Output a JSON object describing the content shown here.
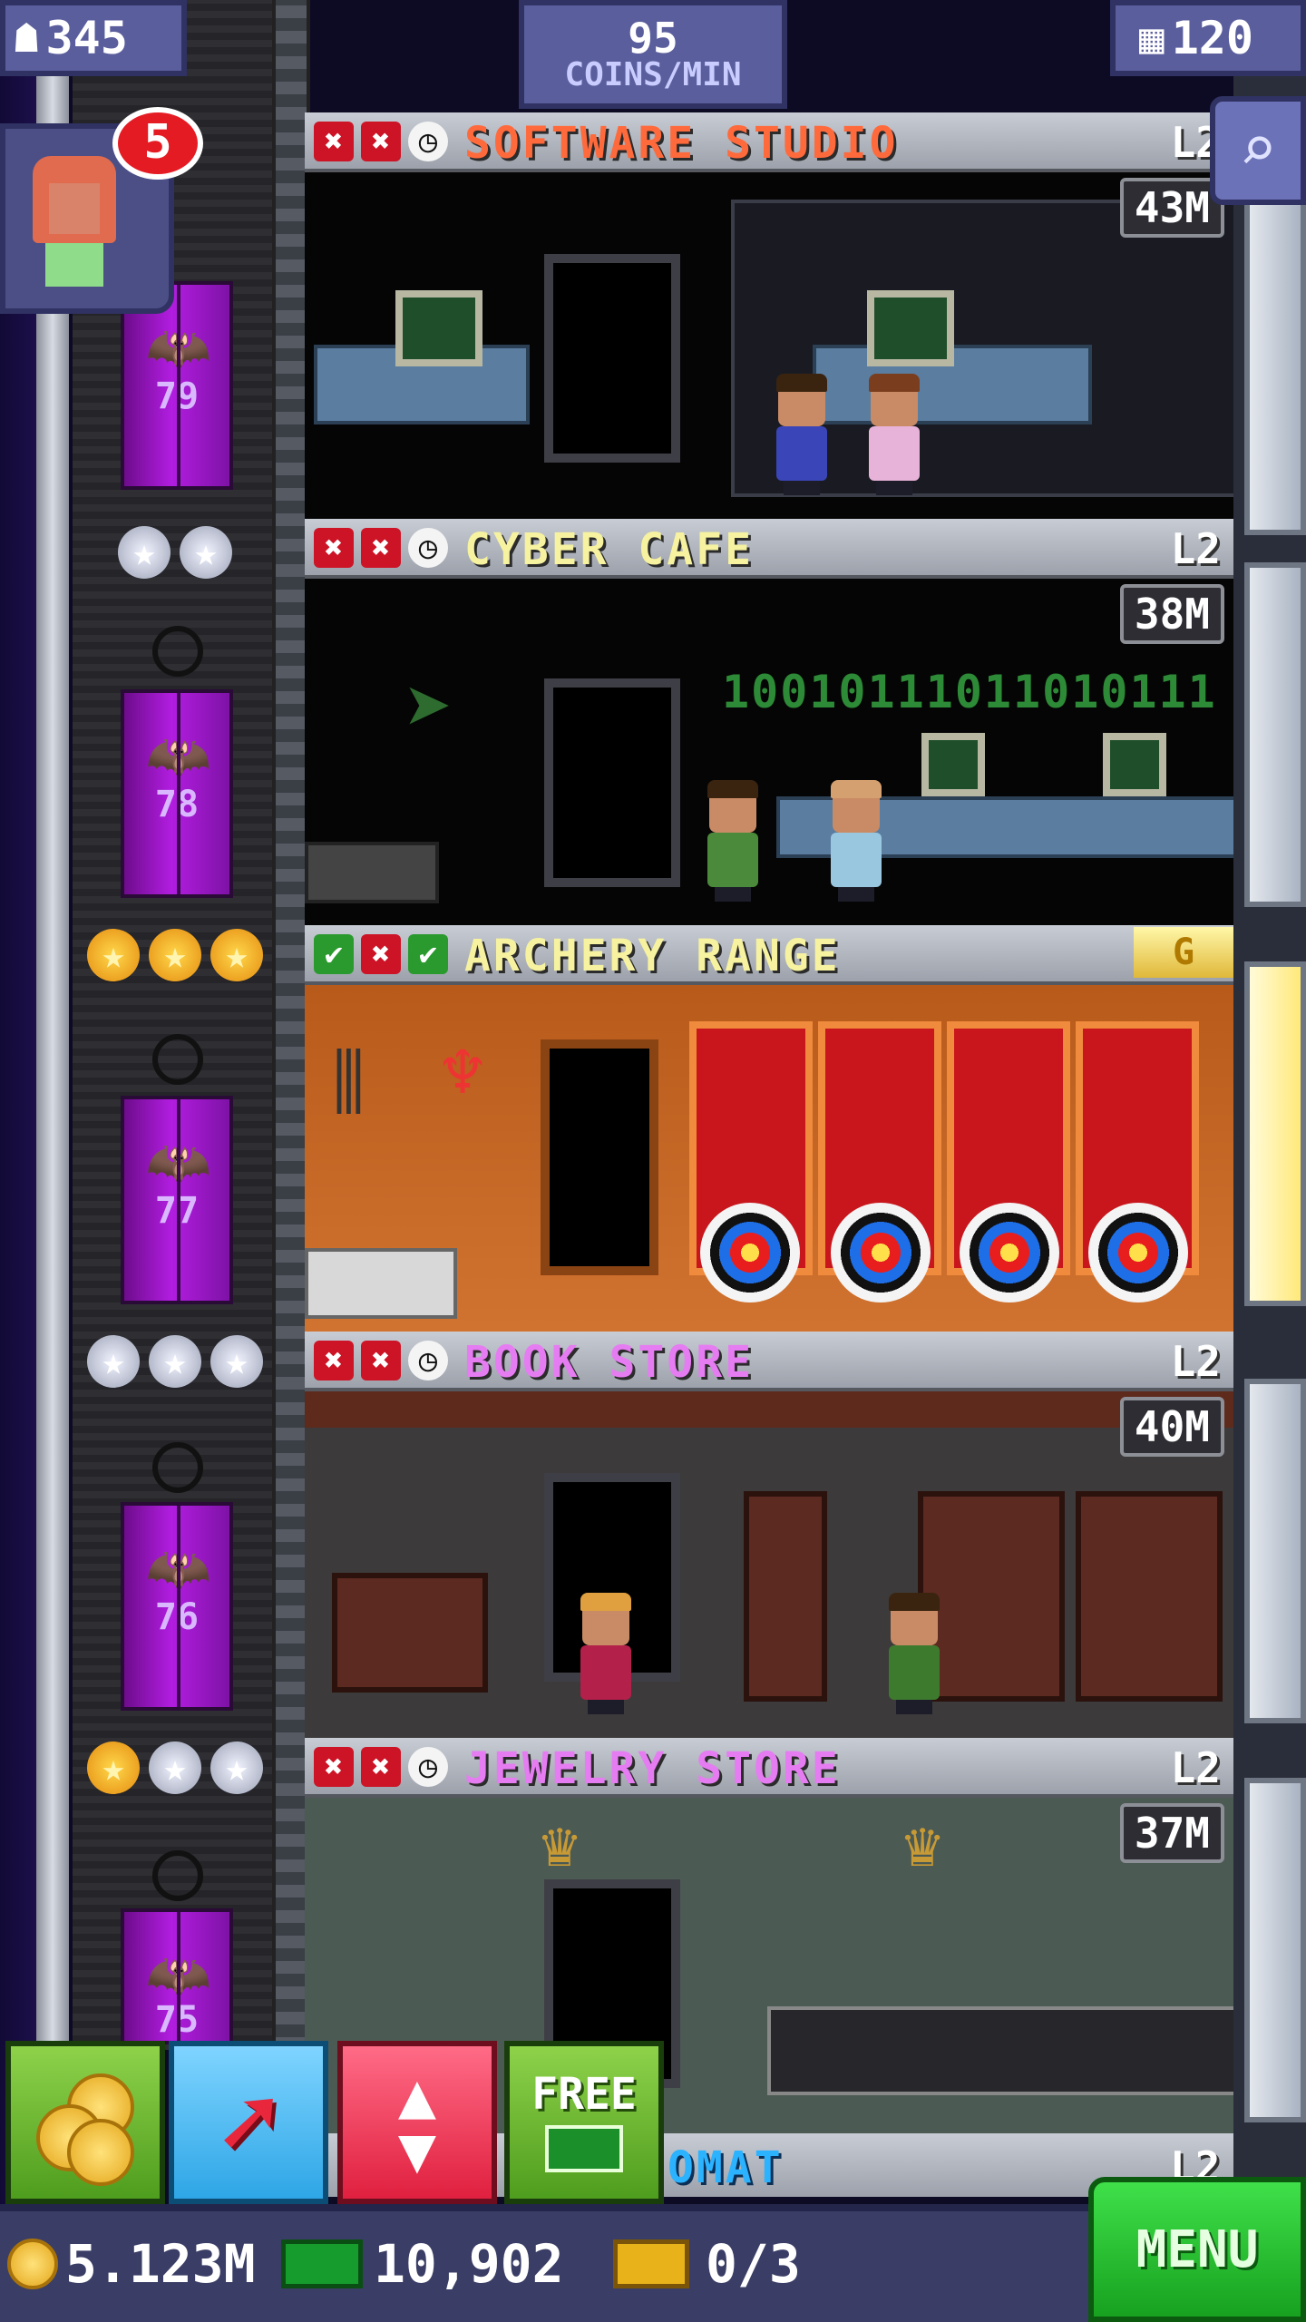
{
  "hud": {
    "population": "345",
    "coins_per_min_value": "95",
    "coins_per_min_unit": "COINS/MIN",
    "floor_count": "120"
  },
  "notification": {
    "count": "5"
  },
  "floors": [
    {
      "name": "SOFTWARE STUDIO",
      "level": "L2",
      "stock": "43M",
      "status": [
        "x",
        "x",
        "clock"
      ],
      "name_color": "#ff6a3c",
      "floor_number": "79",
      "stars": [
        "silver",
        "silver"
      ]
    },
    {
      "name": "CYBER CAFE",
      "level": "L2",
      "stock": "38M",
      "status": [
        "x",
        "x",
        "clock"
      ],
      "name_color": "#f6f2a0",
      "floor_number": "78",
      "stars": [
        "silver",
        "silver"
      ]
    },
    {
      "name": "ARCHERY RANGE",
      "level": "",
      "stock": "",
      "status": [
        "ok",
        "x",
        "ok"
      ],
      "name_color": "#f6f2a0",
      "gold_tag": "G",
      "floor_number": "77",
      "stars": [
        "gold",
        "gold",
        "gold"
      ]
    },
    {
      "name": "BOOK STORE",
      "level": "L2",
      "stock": "40M",
      "status": [
        "x",
        "x",
        "clock"
      ],
      "name_color": "#e67cf2",
      "floor_number": "76",
      "stars": [
        "silver",
        "silver",
        "silver"
      ]
    },
    {
      "name": "JEWELRY STORE",
      "level": "L2",
      "stock": "37M",
      "status": [
        "x",
        "x",
        "clock"
      ],
      "name_color": "#e67cf2",
      "floor_number": "75",
      "stars": [
        "gold",
        "silver",
        "silver"
      ]
    }
  ],
  "cyber_cafe_binary": "10010111011010111",
  "partial_floor_label": "OMAT",
  "partial_floor_level": "L2",
  "actions": {
    "free_label": "FREE"
  },
  "balance": {
    "coins": "5.123M",
    "bux": "10,902",
    "tickets": "0/3"
  },
  "menu_label": "MENU",
  "colors": {
    "door_purple": "#b21de0",
    "hud_blue": "#5a5e9c",
    "menu_green": "#17a11f"
  }
}
